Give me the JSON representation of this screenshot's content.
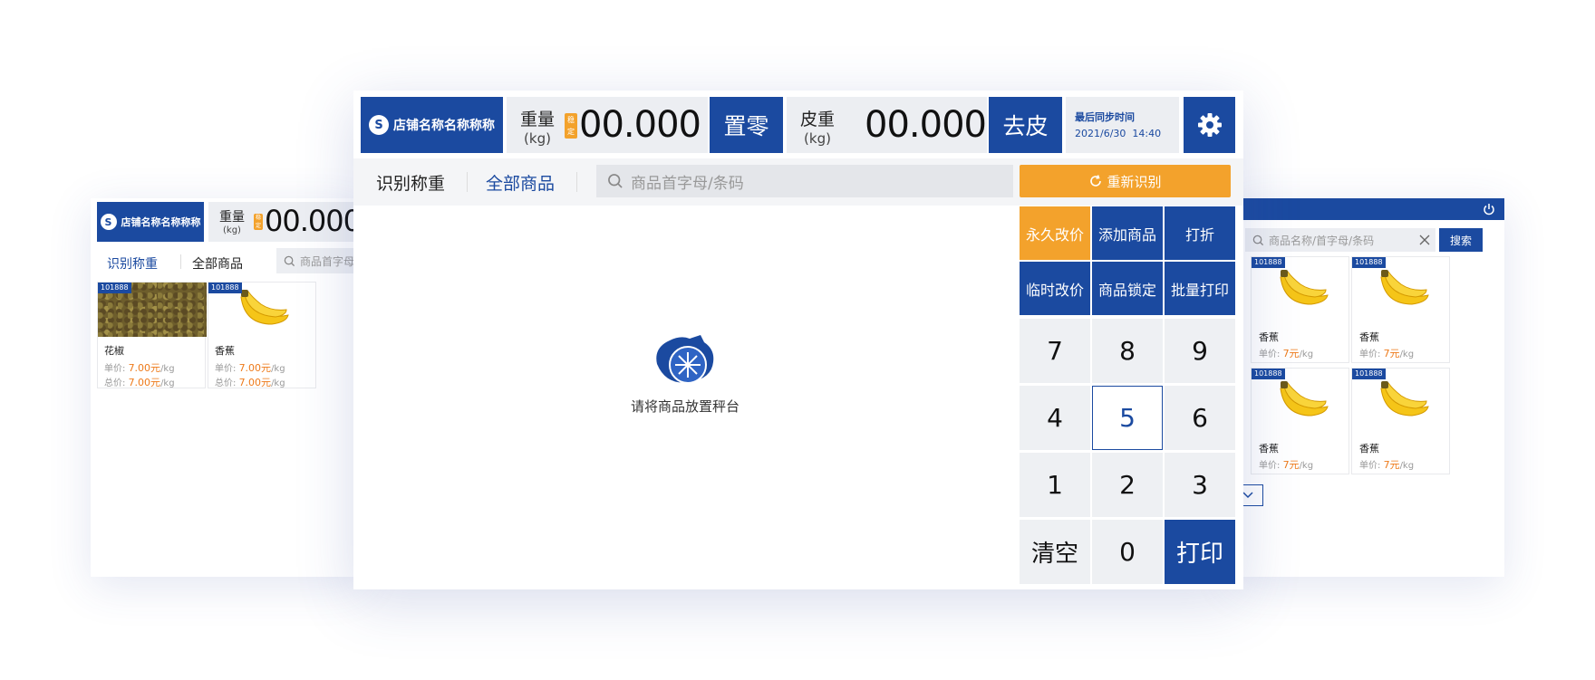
{
  "store": {
    "name": "店铺名称名称称称"
  },
  "scale": {
    "weight_label": "重量",
    "unit": "(kg)",
    "stable_badge": "稳定",
    "weight_value": "00.000",
    "zero_button": "置零",
    "tare_label": "皮重",
    "tare_value": "00.000",
    "tare_button": "去皮",
    "sync_label": "最后同步时间",
    "sync_time": "2021/6/30  14:40"
  },
  "tabs": {
    "recognize": "识别称重",
    "all": "全部商品"
  },
  "search": {
    "placeholder_main": "商品首字母/条码",
    "placeholder_left": "商品首字母",
    "placeholder_right": "商品名称/首字母/条码",
    "search_button": "搜索"
  },
  "rerecognize": "重新识别",
  "actions": [
    "永久改价",
    "添加商品",
    "打折",
    "临时改价",
    "商品锁定",
    "批量打印"
  ],
  "keypad": [
    "7",
    "8",
    "9",
    "4",
    "5",
    "6",
    "1",
    "2",
    "3",
    "清空",
    "0",
    "打印"
  ],
  "placeholder_message": "请将商品放置秤台",
  "left_products": [
    {
      "tag": "101888",
      "name": "花椒",
      "unit_label": "单价:",
      "unit_price": "7.00元",
      "per": "/kg",
      "total_label": "总价:",
      "total_price": "7.00元"
    },
    {
      "tag": "101888",
      "name": "香蕉",
      "unit_label": "单价:",
      "unit_price": "7.00元",
      "per": "/kg",
      "total_label": "总价:",
      "total_price": "7.00元"
    }
  ],
  "right_products": [
    {
      "tag": "101888",
      "name": "香蕉",
      "unit_label": "单价:",
      "unit_price": "7元",
      "per": "/kg"
    },
    {
      "tag": "101888",
      "name": "香蕉",
      "unit_label": "单价:",
      "unit_price": "7元",
      "per": "/kg"
    },
    {
      "tag": "101888",
      "name": "香蕉",
      "unit_label": "单价:",
      "unit_price": "7元",
      "per": "/kg"
    },
    {
      "tag": "101888",
      "name": "香蕉",
      "unit_label": "单价:",
      "unit_price": "7元",
      "per": "/kg"
    }
  ],
  "colors": {
    "primary": "#1b4aa0",
    "accent": "#f3a22c",
    "price": "#ee7a1a"
  }
}
